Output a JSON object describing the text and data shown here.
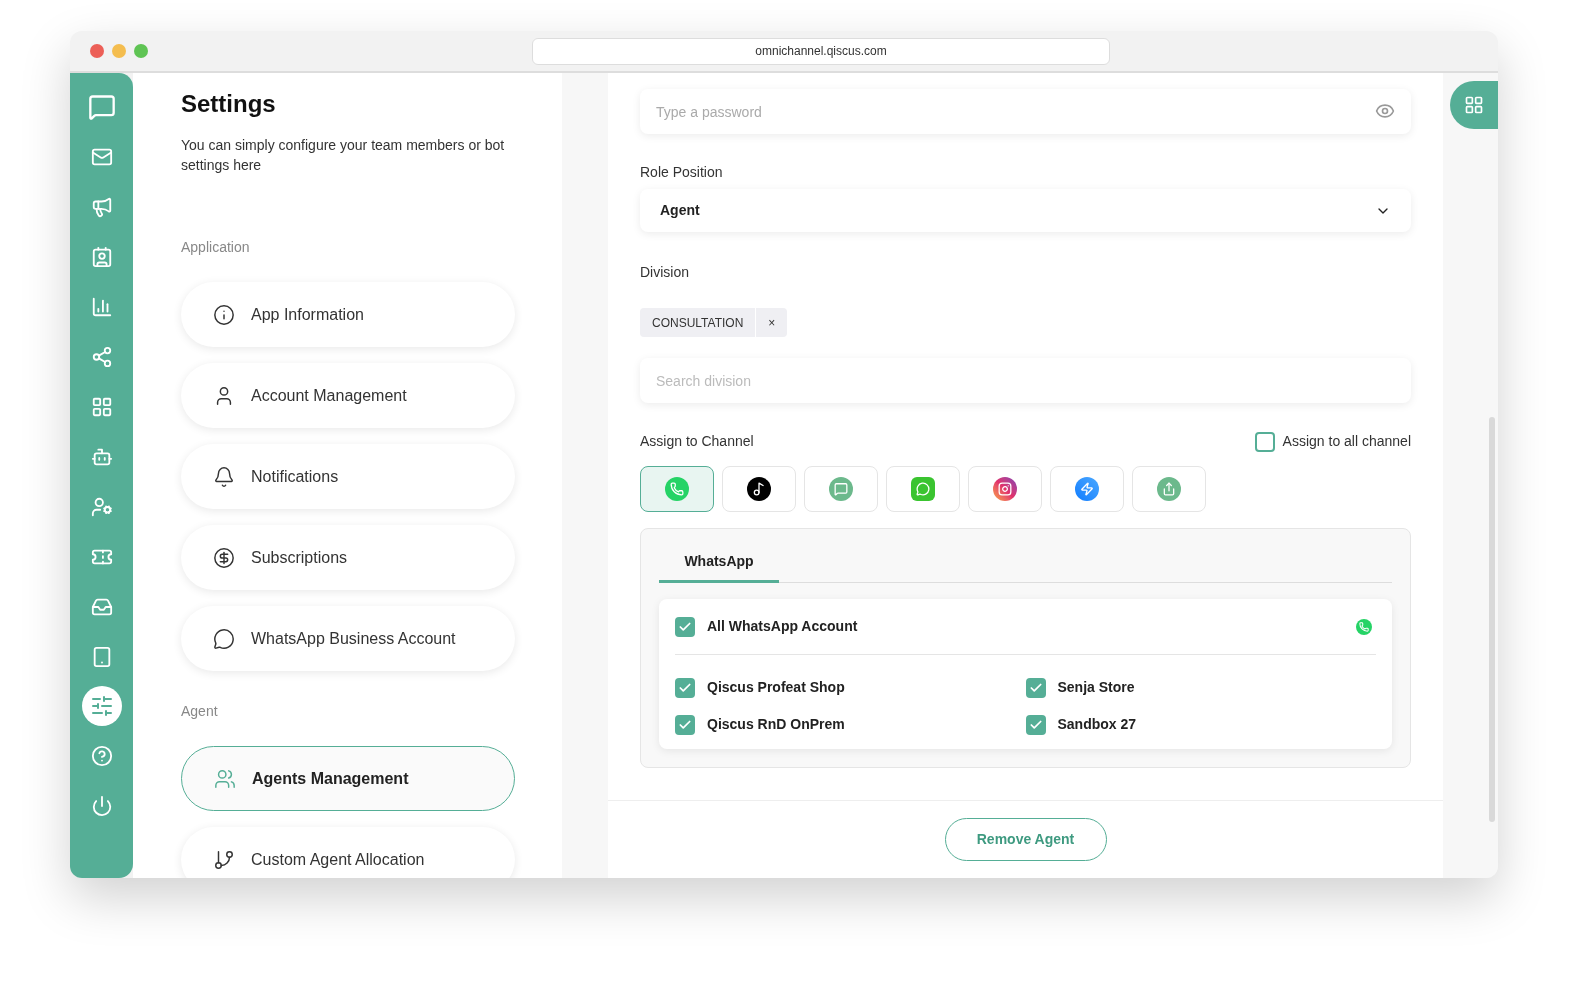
{
  "browser": {
    "url": "omnichannel.qiscus.com"
  },
  "sidebar": {
    "items": [
      {
        "kind": "logo",
        "selected": false
      },
      {
        "kind": "mail",
        "selected": false
      },
      {
        "kind": "megaphone",
        "selected": false
      },
      {
        "kind": "contact",
        "selected": false
      },
      {
        "kind": "chart",
        "selected": false
      },
      {
        "kind": "share",
        "selected": false
      },
      {
        "kind": "apps",
        "selected": false
      },
      {
        "kind": "bot",
        "selected": false
      },
      {
        "kind": "user",
        "selected": false
      },
      {
        "kind": "ticket",
        "selected": false
      },
      {
        "kind": "inbox",
        "selected": false
      },
      {
        "kind": "tablet",
        "selected": false
      },
      {
        "kind": "settings",
        "selected": true
      },
      {
        "kind": "help",
        "selected": false
      },
      {
        "kind": "power",
        "selected": false
      }
    ]
  },
  "settings": {
    "title": "Settings",
    "description": "You can simply configure your team members or bot settings here",
    "sections": [
      {
        "heading": "Application",
        "items": [
          {
            "kind": "info",
            "label": "App Information",
            "selected": false
          },
          {
            "kind": "user",
            "label": "Account Management",
            "selected": false
          },
          {
            "kind": "bell",
            "label": "Notifications",
            "selected": false
          },
          {
            "kind": "subscription",
            "label": "Subscriptions",
            "selected": false
          },
          {
            "kind": "business",
            "label": "WhatsApp Business Account",
            "selected": false
          }
        ]
      },
      {
        "heading": "Agent",
        "items": [
          {
            "kind": "users",
            "label": "Agents Management",
            "selected": true
          },
          {
            "kind": "allocation",
            "label": "Custom Agent Allocation",
            "selected": false
          }
        ]
      }
    ]
  },
  "form": {
    "password": {
      "placeholder": "Type a password"
    },
    "role": {
      "label": "Role Position",
      "value": "Agent"
    },
    "division": {
      "label": "Division",
      "tags": [
        {
          "label": "CONSULTATION",
          "remove": "×"
        }
      ],
      "search_placeholder": "Search division"
    },
    "channel": {
      "label": "Assign to Channel",
      "assign_all": {
        "label": "Assign to all channel",
        "checked": false
      },
      "channels": [
        {
          "kind": "whatsapp",
          "selected": true
        },
        {
          "kind": "tiktok",
          "selected": false
        },
        {
          "kind": "qiscus",
          "selected": false
        },
        {
          "kind": "line",
          "selected": false
        },
        {
          "kind": "instagram",
          "selected": false
        },
        {
          "kind": "messenger",
          "selected": false
        },
        {
          "kind": "custom",
          "selected": false
        }
      ]
    },
    "tabs": [
      {
        "label": "WhatsApp",
        "selected": true
      }
    ],
    "accounts": {
      "all": {
        "label": "All WhatsApp Account",
        "checked": true
      },
      "items": [
        {
          "label": "Qiscus Profeat Shop",
          "checked": true
        },
        {
          "label": "Senja Store",
          "checked": true
        },
        {
          "label": "Qiscus RnD OnPrem",
          "checked": true
        },
        {
          "label": "Sandbox 27",
          "checked": true
        }
      ]
    }
  },
  "footer": {
    "remove_button": "Remove Agent"
  }
}
